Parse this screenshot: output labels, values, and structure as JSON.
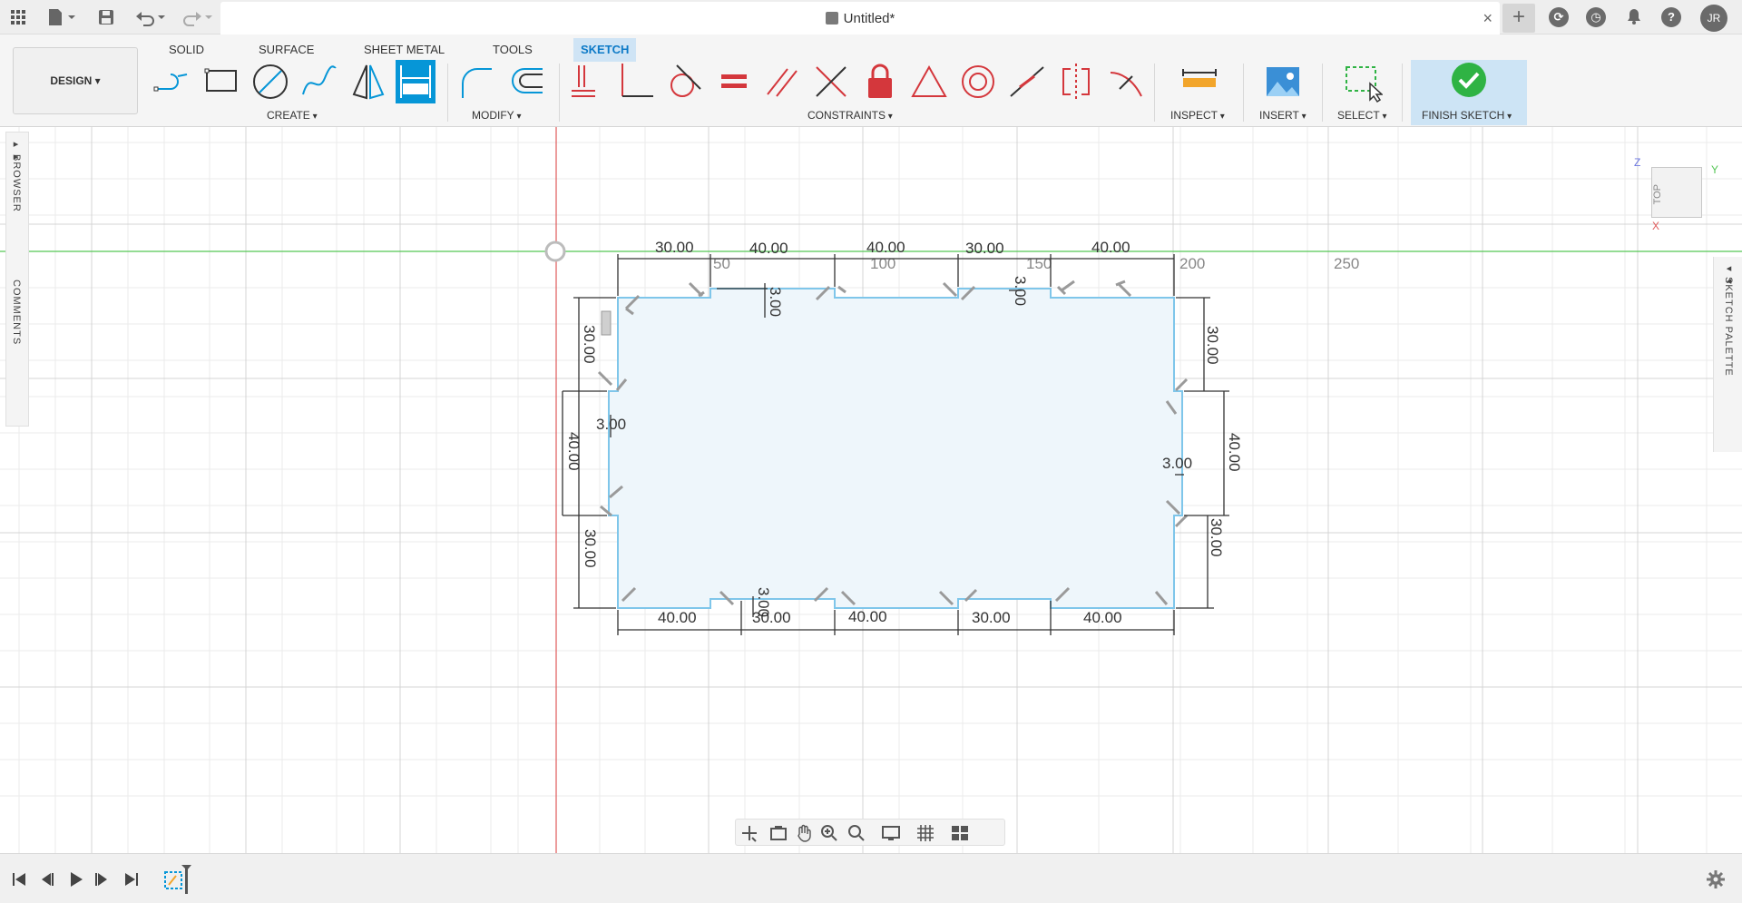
{
  "window": {
    "doc_title": "Untitled*",
    "close_glyph": "×",
    "new_tab_glyph": "+",
    "help_glyph": "?",
    "user_initials": "JR"
  },
  "toolbar": {
    "workspace": "DESIGN",
    "tabs": [
      "SOLID",
      "SURFACE",
      "SHEET METAL",
      "TOOLS",
      "SKETCH"
    ],
    "active_tab": "SKETCH",
    "groups": {
      "create": "CREATE",
      "modify": "MODIFY",
      "constraints": "CONSTRAINTS",
      "inspect": "INSPECT",
      "insert": "INSERT",
      "select": "SELECT",
      "finish": "FINISH SKETCH"
    }
  },
  "panels": {
    "browser": "BROWSER",
    "comments": "COMMENTS",
    "sketch_palette": "SKETCH PALETTE",
    "viewcube_face": "TOP",
    "axis_labels": {
      "z": "Z",
      "y": "Y",
      "x": "X"
    }
  },
  "grid_labels": [
    "50",
    "100",
    "150",
    "200",
    "250"
  ],
  "dimensions": {
    "top": [
      "30.00",
      "40.00",
      "40.00",
      "30.00",
      "40.00"
    ],
    "bottom": [
      "40.00",
      "30.00",
      "40.00",
      "30.00",
      "40.00"
    ],
    "left": [
      "30.00",
      "40.00",
      "30.00"
    ],
    "right": [
      "30.00",
      "40.00",
      "30.00"
    ],
    "thickness": [
      "3.00",
      "3.00",
      "3.00",
      "3.00",
      "3.00"
    ]
  },
  "colors": {
    "accent": "#0696d7",
    "sketch_line": "#7fc6ea",
    "sketch_fill": "#eef6fb",
    "axis_green": "#55c655",
    "axis_red": "#e05a5a",
    "finish_green": "#2fb344",
    "constraint_red": "#d4373c"
  }
}
